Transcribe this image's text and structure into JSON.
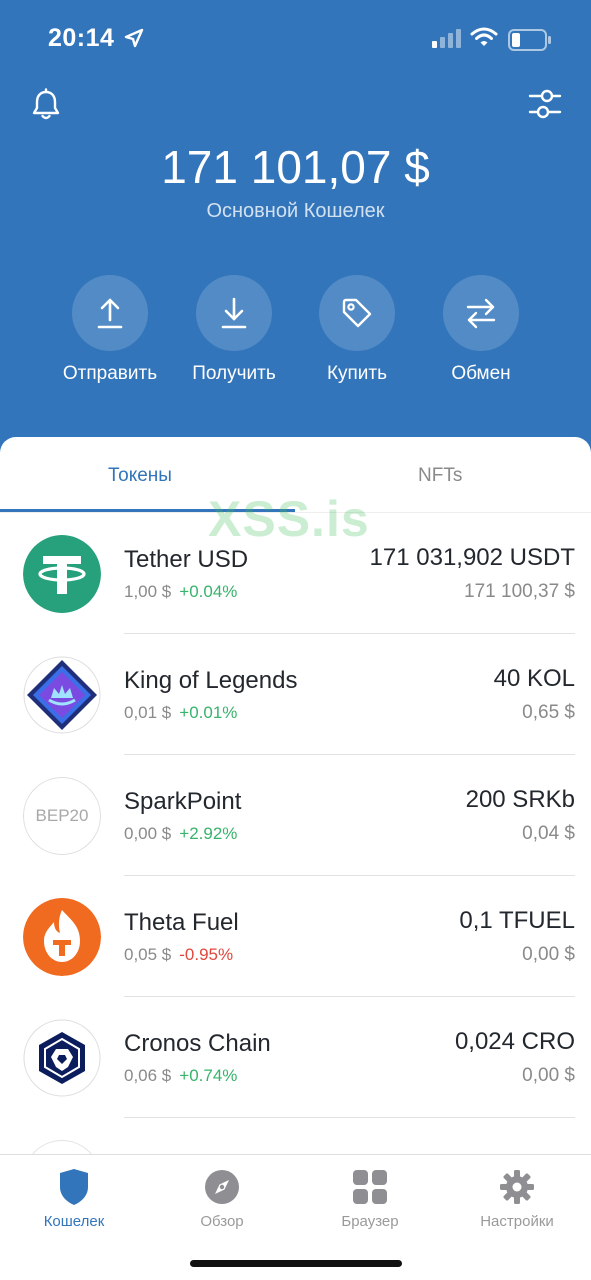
{
  "status_bar": {
    "time": "20:14"
  },
  "wallet": {
    "balance": "171 101,07 $",
    "name": "Основной Кошелек"
  },
  "actions": [
    {
      "label": "Отправить",
      "icon": "arrow-up-icon"
    },
    {
      "label": "Получить",
      "icon": "arrow-down-icon"
    },
    {
      "label": "Купить",
      "icon": "tag-icon"
    },
    {
      "label": "Обмен",
      "icon": "swap-icon"
    }
  ],
  "tabs": [
    {
      "label": "Токены",
      "active": true
    },
    {
      "label": "NFTs",
      "active": false
    }
  ],
  "watermark": "XSS.is",
  "tokens": [
    {
      "name": "Tether USD",
      "price": "1,00 $",
      "change": "+0.04%",
      "amount": "171 031,902 USDT",
      "fiat": "171 100,37 $",
      "icon": "tether-icon"
    },
    {
      "name": "King of Legends",
      "price": "0,01 $",
      "change": "+0.01%",
      "amount": "40 KOL",
      "fiat": "0,65 $",
      "icon": "king-of-legends-icon"
    },
    {
      "name": "SparkPoint",
      "price": "0,00 $",
      "change": "+2.92%",
      "amount": "200 SRKb",
      "fiat": "0,04 $",
      "icon": "bep20-icon",
      "icon_text": "BEP20"
    },
    {
      "name": "Theta Fuel",
      "price": "0,05 $",
      "change": "-0.95%",
      "amount": "0,1 TFUEL",
      "fiat": "0,00 $",
      "icon": "theta-fuel-icon"
    },
    {
      "name": "Cronos Chain",
      "price": "0,06 $",
      "change": "+0.74%",
      "amount": "0,024 CRO",
      "fiat": "0,00 $",
      "icon": "cronos-icon"
    }
  ],
  "bottom_nav": [
    {
      "label": "Кошелек",
      "icon": "shield-icon",
      "active": true
    },
    {
      "label": "Обзор",
      "icon": "compass-icon",
      "active": false
    },
    {
      "label": "Браузер",
      "icon": "grid-icon",
      "active": false
    },
    {
      "label": "Настройки",
      "icon": "gear-icon",
      "active": false
    }
  ],
  "colors": {
    "primary": "#3375bb",
    "positive": "#38b36b",
    "negative": "#e0483d"
  }
}
